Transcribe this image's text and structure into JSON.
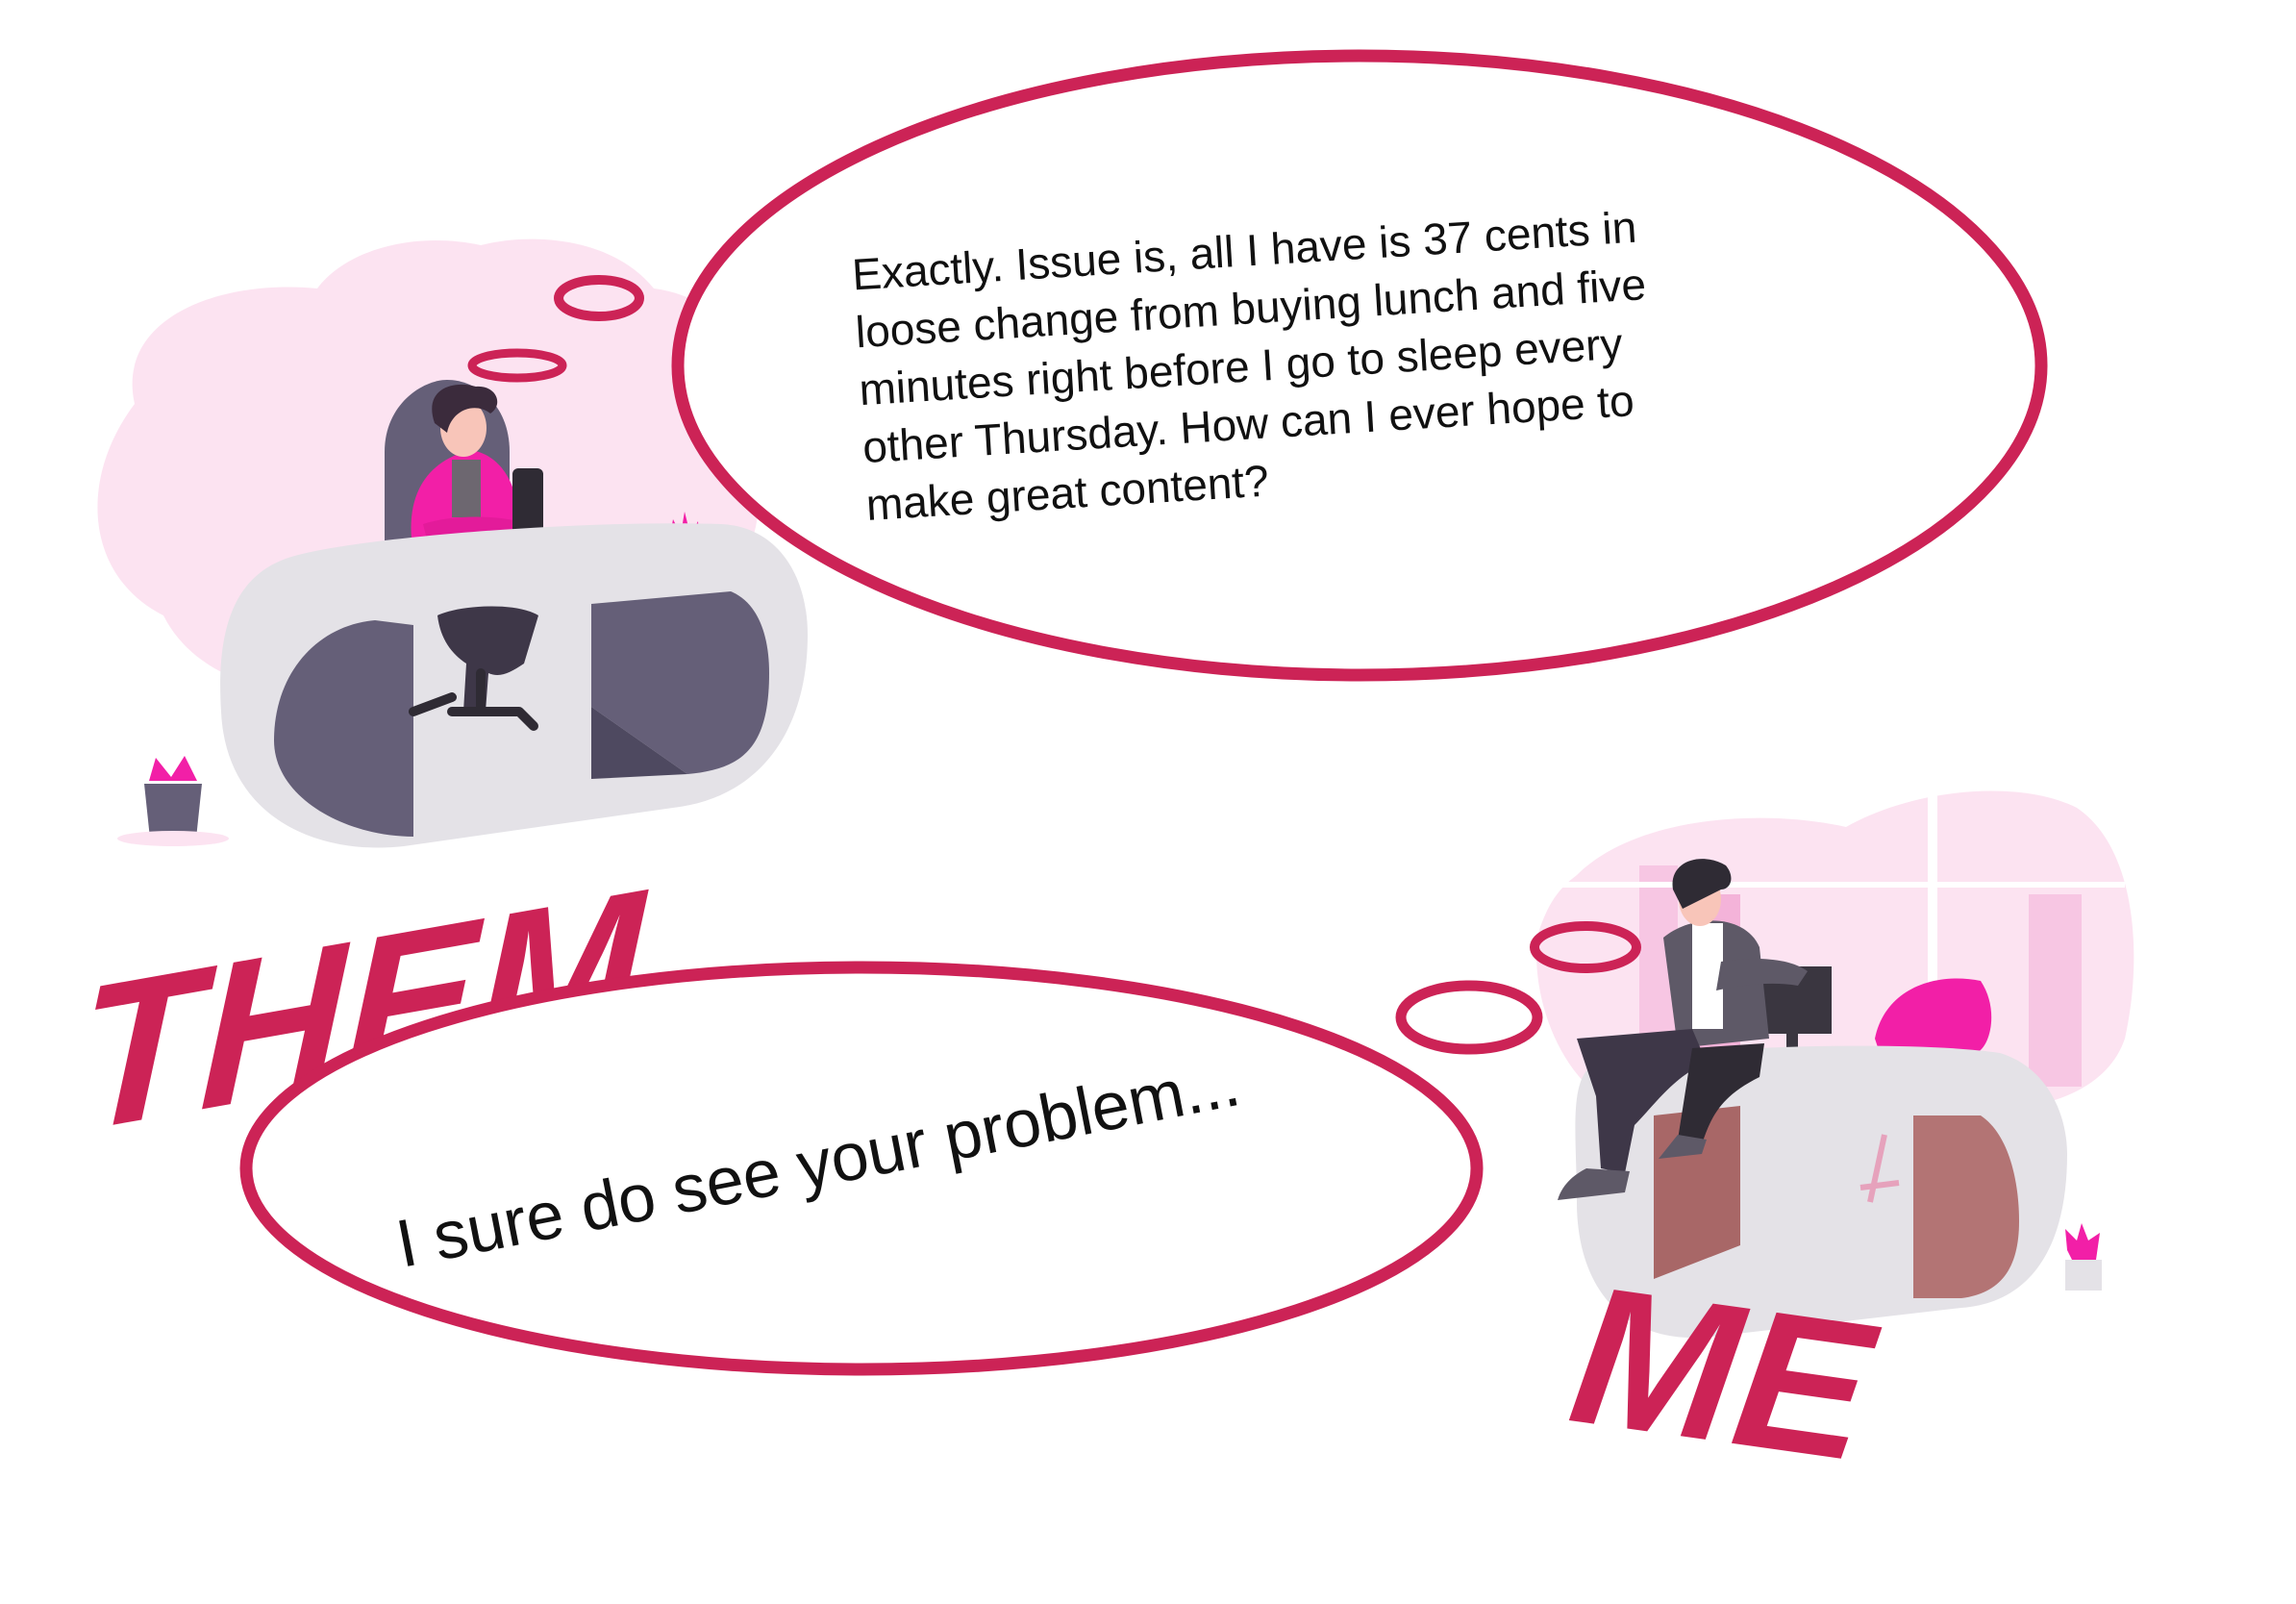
{
  "them_bubble": {
    "lines": [
      "Exactly. Issue is, all I have is 37 cents in",
      "loose change from buying lunch and five",
      "minutes right before I go to sleep every",
      "other Thursday. How can I ever hope to",
      "make great content?"
    ]
  },
  "me_bubble": {
    "text": "I sure do see your problem..."
  },
  "labels": {
    "them": "THEM",
    "me": "ME"
  },
  "colors": {
    "accent": "#cc2356",
    "pink": "#f21fa7",
    "blush": "#fce3f1",
    "desk": "#e4e2e7",
    "desk_dark": "#655f78",
    "desk_red": "#a86767"
  }
}
